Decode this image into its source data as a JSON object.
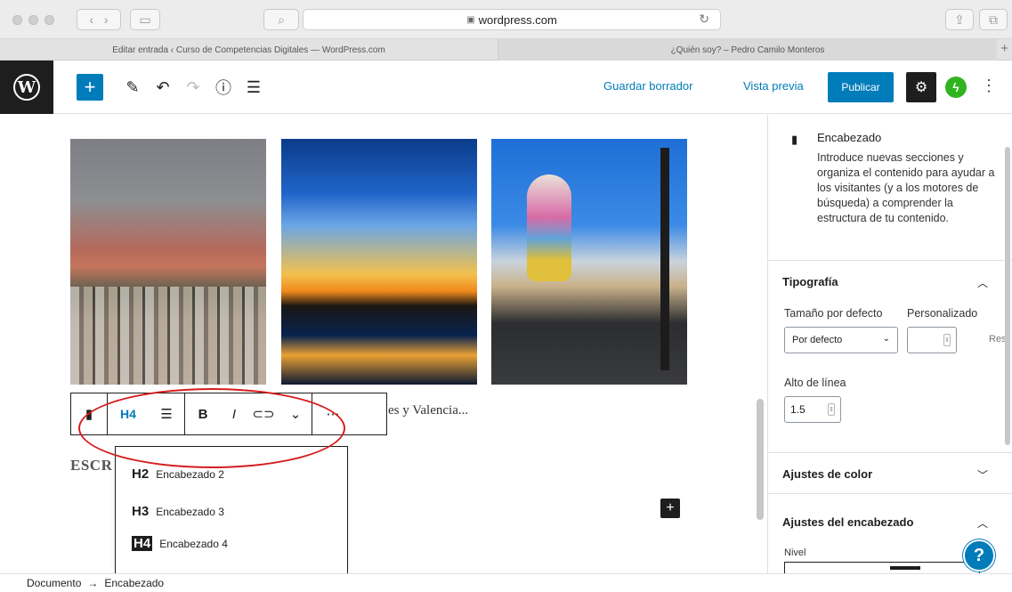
{
  "browser": {
    "url": "wordpress.com",
    "tabs": [
      {
        "label": "Editar entrada ‹ Curso de Competencias Digitales — WordPress.com"
      },
      {
        "label": "¿Quién soy? – Pedro Camilo Monteros"
      }
    ]
  },
  "header": {
    "save_draft": "Guardar borrador",
    "preview": "Vista previa",
    "publish": "Publicar"
  },
  "editor": {
    "block_toolbar": {
      "heading_level": "H4"
    },
    "caption_fragment": "es y Valencia...",
    "heading_fragment": "ESCR",
    "level_menu": [
      {
        "tag": "H2",
        "label": "Encabezado 2"
      },
      {
        "tag": "H3",
        "label": "Encabezado 3"
      },
      {
        "tag": "H4",
        "label": "Encabezado 4"
      }
    ]
  },
  "sidebar": {
    "block": {
      "title": "Encabezado",
      "description": "Introduce nuevas secciones y organiza el contenido para ayudar a los visitantes (y a los motores de búsqueda) a comprender la estructura de tu contenido."
    },
    "typography": {
      "title": "Tipografía",
      "size_label": "Tamaño por defecto",
      "custom_label": "Personalizado",
      "size_value": "Por defecto",
      "reset": "Res",
      "line_height_label": "Alto de línea",
      "line_height_value": "1.5"
    },
    "color": {
      "title": "Ajustes de color"
    },
    "heading_settings": {
      "title": "Ajustes del encabezado",
      "level_label": "Nivel"
    }
  },
  "footer": {
    "breadcrumb": [
      "Documento",
      "Encabezado"
    ]
  },
  "colors": {
    "accent": "#007cba",
    "highlight": "#d51d1d",
    "jetpack": "#2fb41f"
  }
}
